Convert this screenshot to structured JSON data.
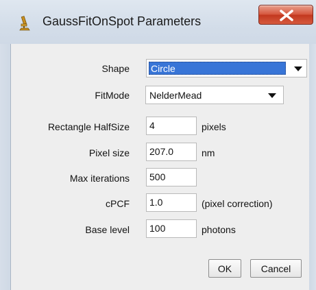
{
  "window": {
    "title": "GaussFitOnSpot Parameters",
    "icon": "microscope-icon",
    "close_icon": "close-icon"
  },
  "form": {
    "shape": {
      "label": "Shape",
      "selected": "Circle"
    },
    "fitmode": {
      "label": "FitMode",
      "selected": "NelderMead"
    },
    "rect_halfsize": {
      "label": "Rectangle HalfSize",
      "value": "4",
      "unit": "pixels"
    },
    "pixel_size": {
      "label": "Pixel size",
      "value": "207.0",
      "unit": "nm"
    },
    "max_iterations": {
      "label": "Max iterations",
      "value": "500"
    },
    "cpcf": {
      "label": "cPCF",
      "value": "1.0",
      "unit": "(pixel correction)"
    },
    "base_level": {
      "label": "Base level",
      "value": "100",
      "unit": "photons"
    }
  },
  "buttons": {
    "ok": "OK",
    "cancel": "Cancel"
  },
  "colors": {
    "selection": "#3875d7",
    "close_button": "#c2381f",
    "dialog_bg": "#eeeeee"
  }
}
